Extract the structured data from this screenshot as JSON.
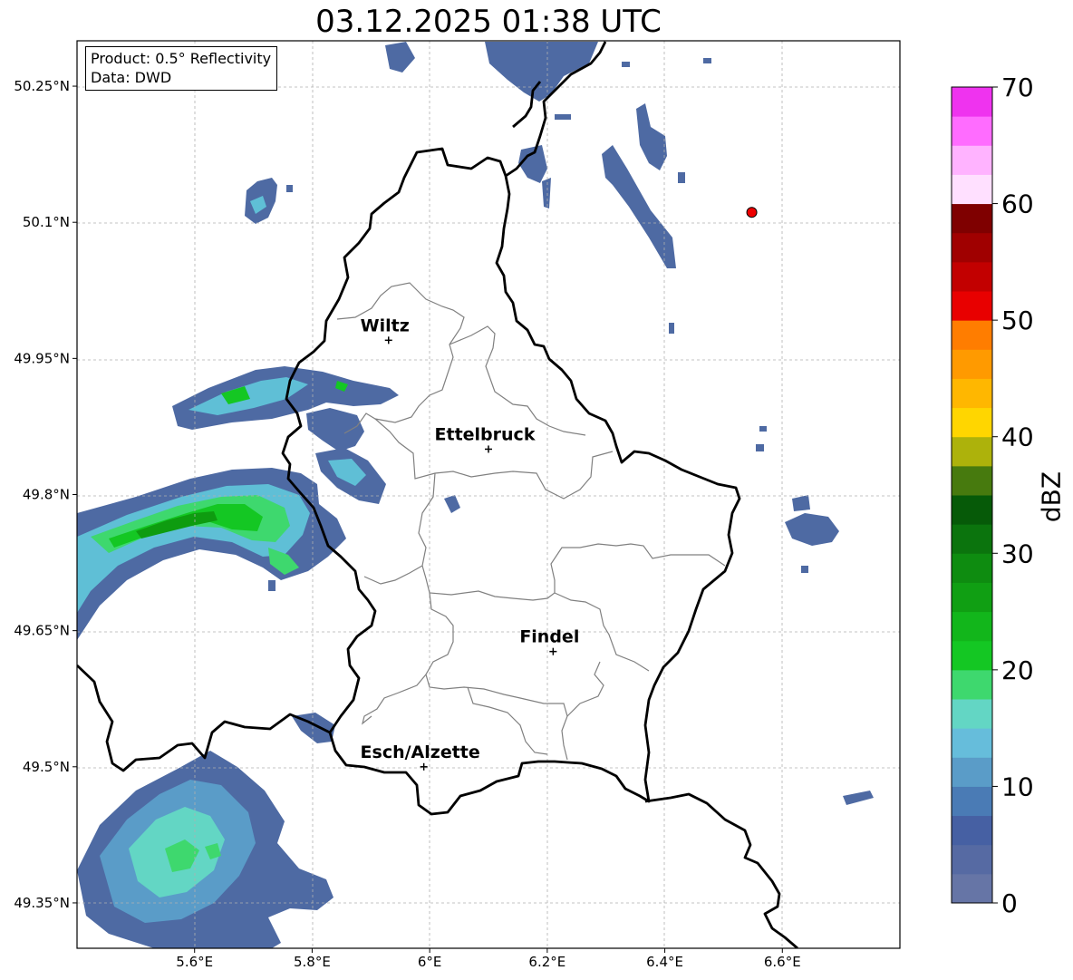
{
  "title": "03.12.2025 01:38 UTC",
  "infobox": {
    "product": "Product: 0.5° Reflectivity",
    "data": "Data: DWD"
  },
  "colorbar": {
    "label": "dBZ",
    "min": 0,
    "max": 70,
    "step": 2.5,
    "ticks": [
      "0",
      "10",
      "20",
      "30",
      "40",
      "50",
      "60",
      "70"
    ],
    "colors": [
      "#6675a6",
      "#566aa3",
      "#4660a3",
      "#4a7bb5",
      "#5a9cc8",
      "#66bddb",
      "#63d6c4",
      "#3ed86e",
      "#14c723",
      "#12b61b",
      "#109f13",
      "#0e8c10",
      "#0b740d",
      "#065a08",
      "#477a0e",
      "#adb20b",
      "#ffd600",
      "#ffb700",
      "#ff9a00",
      "#ff7d00",
      "#e80000",
      "#c20000",
      "#a00000",
      "#7f0000",
      "#ffe0ff",
      "#ffb3ff",
      "#ff6cff",
      "#ef33ef"
    ]
  },
  "map": {
    "extent": {
      "lon": [
        5.4,
        6.8
      ],
      "lat": [
        49.3,
        50.3
      ]
    },
    "lon_ticks": [
      {
        "value": 5.6,
        "label": "5.6°E"
      },
      {
        "value": 5.8,
        "label": "5.8°E"
      },
      {
        "value": 6.0,
        "label": "6°E"
      },
      {
        "value": 6.2,
        "label": "6.2°E"
      },
      {
        "value": 6.4,
        "label": "6.4°E"
      },
      {
        "value": 6.6,
        "label": "6.6°E"
      }
    ],
    "lat_ticks": [
      {
        "value": 50.25,
        "label": "50.25°N"
      },
      {
        "value": 50.1,
        "label": "50.1°N"
      },
      {
        "value": 49.95,
        "label": "49.95°N"
      },
      {
        "value": 49.8,
        "label": "49.8°N"
      },
      {
        "value": 49.65,
        "label": "49.65°N"
      },
      {
        "value": 49.5,
        "label": "49.5°N"
      },
      {
        "value": 49.35,
        "label": "49.35°N"
      }
    ],
    "cities": [
      {
        "name": "Wiltz",
        "lon": 5.93,
        "lat": 49.97
      },
      {
        "name": "Ettelbruck",
        "lon": 6.1,
        "lat": 49.85
      },
      {
        "name": "Findel",
        "lon": 6.21,
        "lat": 49.627
      },
      {
        "name": "Esch/Alzette",
        "lon": 5.99,
        "lat": 49.5
      }
    ],
    "radar_site": {
      "lon": 6.548,
      "lat": 50.111,
      "color": "#ee0000"
    }
  }
}
